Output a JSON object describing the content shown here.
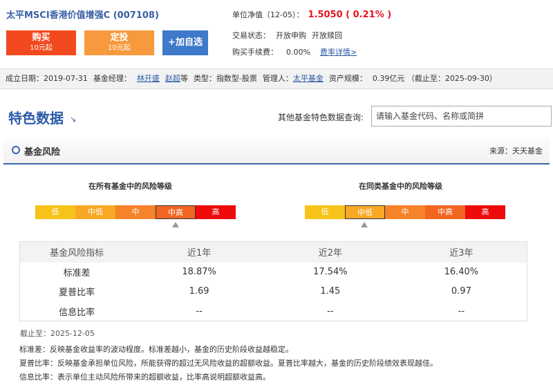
{
  "header": {
    "fund_title": "太平MSCI香港价值增强C (007108)",
    "nav_label": "单位净值（12-05）：",
    "nav_value": "1.5050 ( 0.21% )",
    "status_label": "交易状态：",
    "status_purchase": "开放申购",
    "status_redeem": "开放赎回",
    "fee_label": "购买手续费：",
    "fee_value": "0.00%",
    "fee_link": "费率详情>"
  },
  "buttons": {
    "buy_label": "购买",
    "buy_sub": "10元起",
    "plan_label": "定投",
    "plan_sub": "10元起",
    "fav_label": "+加自选"
  },
  "meta": {
    "inception_label": "成立日期：",
    "inception_value": "2019-07-31",
    "manager_label": "基金经理：",
    "manager_1": "林开盛",
    "manager_2": "赵超",
    "manager_suffix": "等",
    "type_label": "类型：",
    "type_value": "指数型-股票",
    "company_label": "管理人：",
    "company_value": "太平基金",
    "size_label": "资产规模：",
    "size_value": "0.39亿元 （截止至：2025-09-30）"
  },
  "section": {
    "title": "特色数据",
    "arrow": "↘",
    "query_label": "其他基金特色数据查询:",
    "search_placeholder": "请输入基金代码、名称或简拼"
  },
  "risk": {
    "title": "基金风险",
    "source": "来源：天天基金",
    "scale_all_title": "在所有基金中的风险等级",
    "scale_peer_title": "在同类基金中的风险等级",
    "scale_all": [
      {
        "label": "低",
        "color": "#f7c31a"
      },
      {
        "label": "中低",
        "color": "#f9a825"
      },
      {
        "label": "中",
        "color": "#f6822a"
      },
      {
        "label": "中高",
        "color": "#f26522"
      },
      {
        "label": "高",
        "color": "#ee0b0b"
      }
    ],
    "scale_all_active": 3,
    "scale_peer": [
      {
        "label": "低",
        "color": "#f7c31a"
      },
      {
        "label": "中低",
        "color": "#f9a825"
      },
      {
        "label": "中",
        "color": "#f6822a"
      },
      {
        "label": "中高",
        "color": "#f26522"
      },
      {
        "label": "高",
        "color": "#ee0b0b"
      }
    ],
    "scale_peer_active": 1
  },
  "metrics": {
    "headers": [
      "基金风险指标",
      "近1年",
      "近2年",
      "近3年"
    ],
    "rows": [
      [
        "标准差",
        "18.87%",
        "17.54%",
        "16.40%"
      ],
      [
        "夏普比率",
        "1.69",
        "1.45",
        "0.97"
      ],
      [
        "信息比率",
        "--",
        "--",
        "--"
      ]
    ],
    "asof": "截止至：2025-12-05"
  },
  "notes": {
    "std": "标准差：反映基金收益率的波动程度。标准差越小，基金的历史阶段收益越稳定。",
    "sharpe": "夏普比率：反映基金承担单位风险，所能获得的超过无风险收益的超额收益。夏普比率越大，基金的历史阶段绩效表现越佳。",
    "info": "信息比率：表示单位主动风险所带来的超额收益，比率高说明超额收益高。"
  }
}
